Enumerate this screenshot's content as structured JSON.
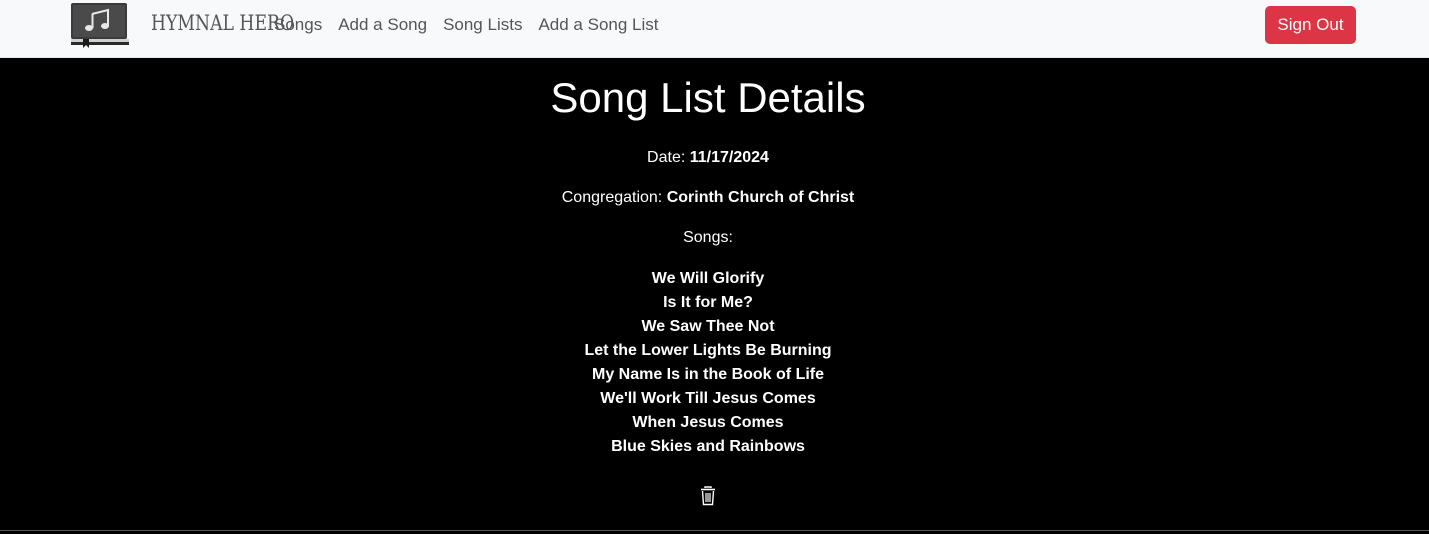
{
  "nav": {
    "brand_name": "HYMNAL HERO",
    "logo_icon": "hymnal-book-music-note-icon",
    "links": [
      "Songs",
      "Add a Song",
      "Song Lists",
      "Add a Song List"
    ],
    "sign_out_label": "Sign Out",
    "colors": {
      "navbar_bg": "#f8f9fa",
      "sign_out_bg": "#dc3545"
    }
  },
  "details": {
    "title": "Song List Details",
    "date_label": "Date:",
    "date_value": "11/17/2024",
    "congregation_label": "Congregation:",
    "congregation_value": "Corinth Church of Christ",
    "songs_label": "Songs:",
    "songs": [
      "We Will Glorify",
      "Is It for Me?",
      "We Saw Thee Not",
      "Let the Lower Lights Be Burning",
      "My Name Is in the Book of Life",
      "We'll Work Till Jesus Comes",
      "When Jesus Comes",
      "Blue Skies and Rainbows"
    ],
    "delete_icon": "trash-icon"
  }
}
